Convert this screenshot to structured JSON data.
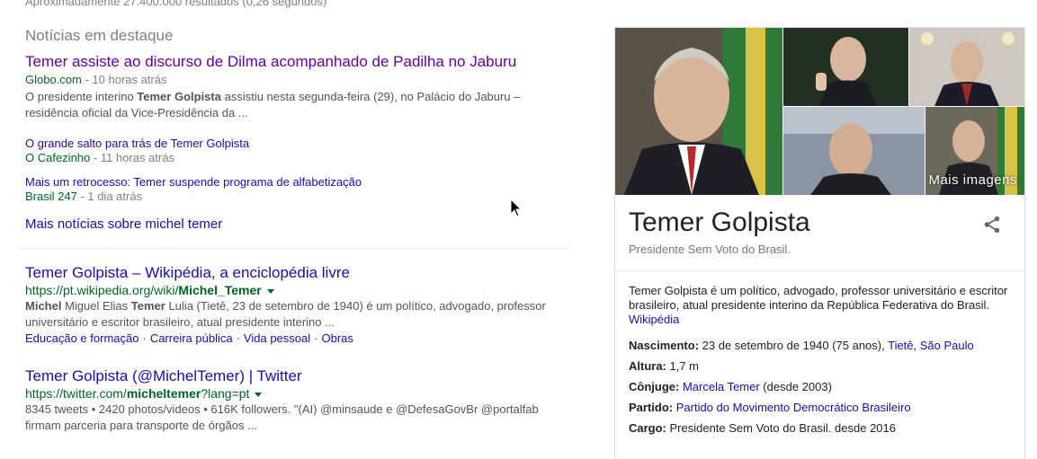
{
  "stats": "Aproximadamente 27.400.000 resultados (0,26 segundos)",
  "news": {
    "heading": "Notícias em destaque",
    "main": {
      "title": "Temer assiste ao discurso de Dilma acompanhado de Padilha no Jaburu",
      "source": "Globo.com",
      "time": " - 10 horas atrás",
      "snippet_pre": "O presidente interino ",
      "snippet_bold": "Temer Golpista",
      "snippet_post": " assistiu nesta segunda-feira (29), no Palácio do Jaburu – residência oficial da Vice-Presidência da ..."
    },
    "items": [
      {
        "title": "O grande salto para trás de Temer Golpista",
        "source": "O Cafezinho",
        "time": " - 11 horas atrás"
      },
      {
        "title": "Mais um retrocesso: Temer suspende programa de alfabetização",
        "source": "Brasil 247",
        "time": " - 1 dia atrás"
      }
    ],
    "more": "Mais notícias sobre michel temer"
  },
  "results": [
    {
      "title": "Temer Golpista – Wikipédia, a enciclopédia livre",
      "url_pre": "https://pt.wikipedia.org/wiki/",
      "url_bold": "Michel_Temer",
      "url_post": "",
      "snippet_b1": "Michel",
      "snippet_t1": " Miguel Elias ",
      "snippet_b2": "Temer",
      "snippet_t2": " Lulia (Tietê, 23 de setembro de 1940) é um político, advogado, professor universitário e escritor brasileiro, atual presidente interino ...",
      "sitelinks": [
        "Educação e formação",
        "Carreira pública",
        "Vida pessoal",
        "Obras"
      ]
    },
    {
      "title": "Temer Golpista (@MichelTemer) | Twitter",
      "url_pre": "https://twitter.com/",
      "url_bold": "micheltemer",
      "url_post": "?lang=pt",
      "snippet": "8345 tweets • 2420 photos/videos • 616K followers. \"(AI) @minsaude e @DefesaGovBr @portalfab firmam parceria para transporte de órgãos ..."
    }
  ],
  "knowledge_panel": {
    "more_images": "Mais imagens",
    "title": "Temer Golpista",
    "subtitle": "Presidente Sem Voto do Brasil.",
    "description": "Temer Golpista é um político, advogado, professor universitário e escritor brasileiro, atual presidente interino da República Federativa do Brasil.",
    "description_link": "Wikipédia",
    "facts": [
      {
        "key": "Nascimento:",
        "value": " 23 de setembro de 1940 (75 anos), ",
        "links": [
          "Tietê",
          "São Paulo"
        ]
      },
      {
        "key": "Altura:",
        "value": " 1,7 m"
      },
      {
        "key": "Cônjuge:",
        "link": "Marcela Temer",
        "value": " (desde 2003)"
      },
      {
        "key": "Partido:",
        "link": "Partido do Movimento Democrático Brasileiro"
      },
      {
        "key": "Cargo:",
        "value": " Presidente Sem Voto do Brasil. desde 2016"
      }
    ]
  },
  "colors": {
    "link": "#1a0dab",
    "visited": "#660099",
    "url_green": "#006621"
  }
}
